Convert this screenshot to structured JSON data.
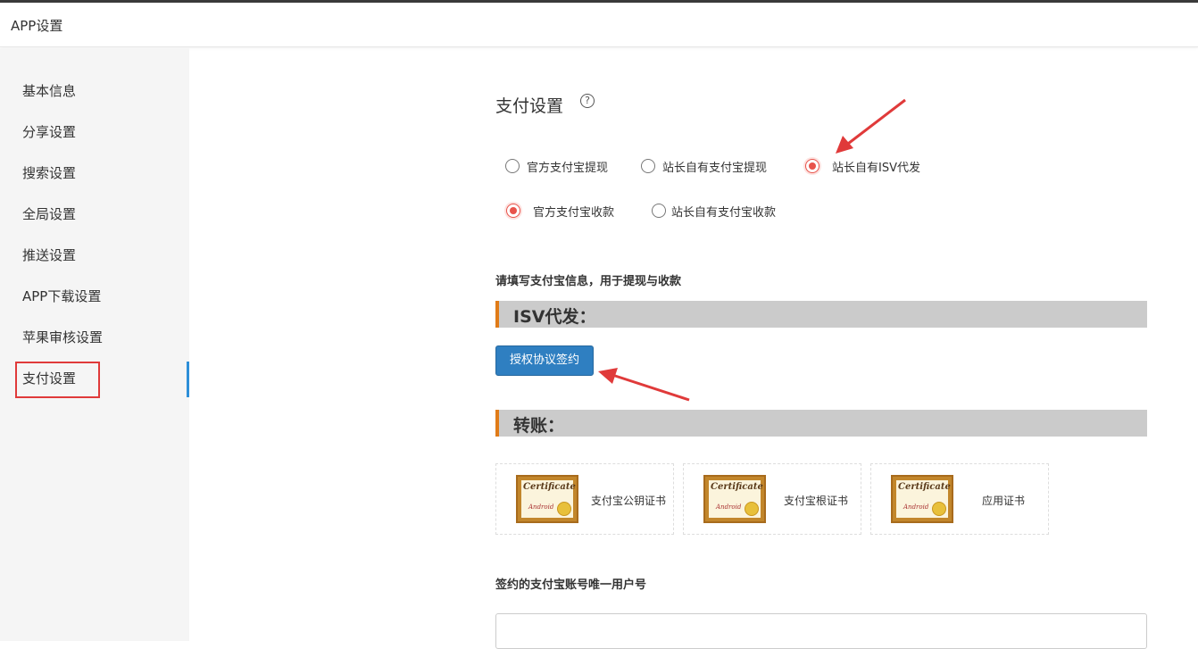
{
  "header": {
    "title": "APP设置"
  },
  "sidebar": {
    "items": [
      {
        "label": "基本信息"
      },
      {
        "label": "分享设置"
      },
      {
        "label": "搜索设置"
      },
      {
        "label": "全局设置"
      },
      {
        "label": "推送设置"
      },
      {
        "label": "APP下载设置"
      },
      {
        "label": "苹果审核设置"
      },
      {
        "label": "支付设置",
        "active": true
      }
    ]
  },
  "main": {
    "section_title": "支付设置",
    "help_icon": "?",
    "withdraw_options": [
      {
        "label": "官方支付宝提现",
        "checked": false
      },
      {
        "label": "站长自有支付宝提现",
        "checked": false
      },
      {
        "label": "站长自有ISV代发",
        "checked": true
      }
    ],
    "collect_options": [
      {
        "label": "官方支付宝收款",
        "checked": true
      },
      {
        "label": "站长自有支付宝收款",
        "checked": false
      }
    ],
    "hint": "请填写支付宝信息，用于提现与收款",
    "isv_heading": "ISV代发：",
    "auth_button": "授权协议签约",
    "transfer_heading": "转账：",
    "certificates": [
      {
        "label": "支付宝公钥证书",
        "image_title": "Certificate",
        "image_sub": "Android"
      },
      {
        "label": "支付宝根证书",
        "image_title": "Certificate",
        "image_sub": "Android"
      },
      {
        "label": "应用证书",
        "image_title": "Certificate",
        "image_sub": "Android"
      }
    ],
    "uid_label": "签约的支付宝账号唯一用户号",
    "uid_value": ""
  },
  "colors": {
    "accent_bar": "#e07b18",
    "button": "#2f7fc1",
    "radio_checked": "#e8534b",
    "annotation": "#e03a3a",
    "active_indicator": "#2e8fd8"
  }
}
